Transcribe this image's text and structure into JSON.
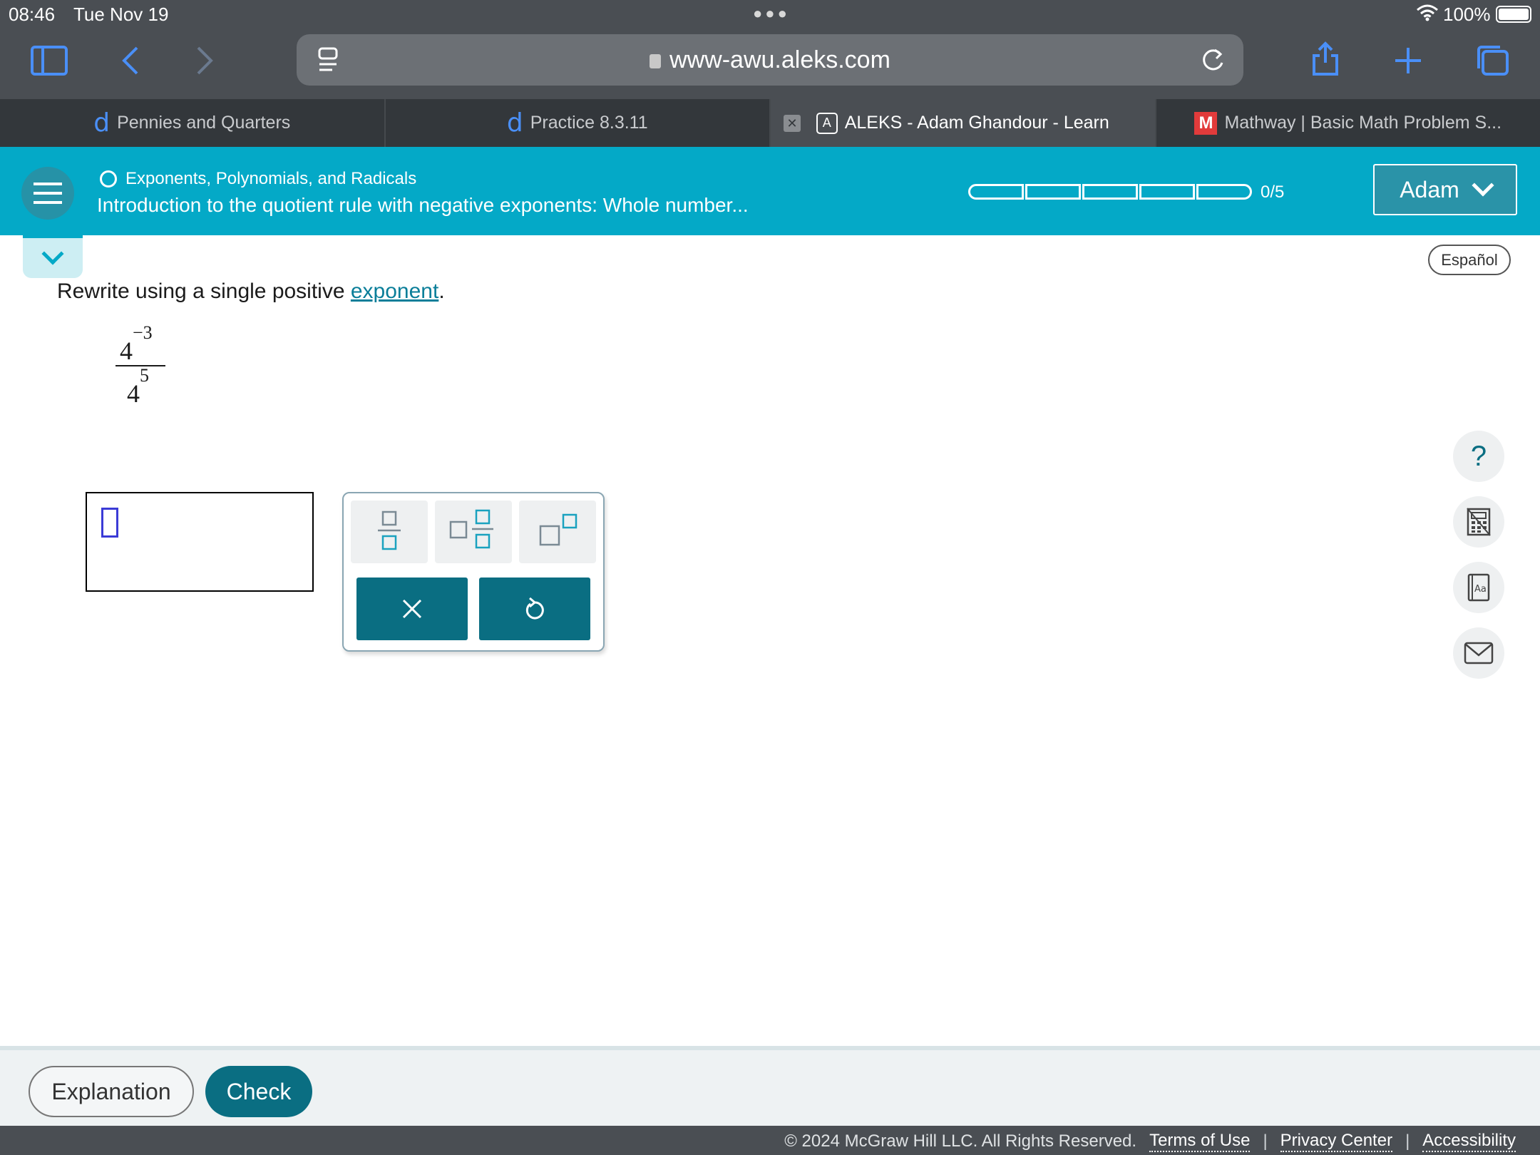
{
  "status_bar": {
    "time": "08:46",
    "date": "Tue Nov 19",
    "battery": "100%"
  },
  "browser": {
    "url": "www-awu.aleks.com",
    "tabs": [
      {
        "label": "Pennies and Quarters",
        "favicon": "d"
      },
      {
        "label": "Practice 8.3.11",
        "favicon": "d"
      },
      {
        "label": "ALEKS - Adam Ghandour - Learn",
        "favicon": "A"
      },
      {
        "label": "Mathway | Basic Math Problem S...",
        "favicon": "M"
      }
    ]
  },
  "header": {
    "topic": "Exponents, Polynomials, and Radicals",
    "lesson": "Introduction to the quotient rule with negative exponents: Whole number...",
    "progress_label": "0/5",
    "progress": {
      "completed": 0,
      "total": 5
    },
    "user": "Adam"
  },
  "content": {
    "language_button": "Español",
    "prompt_text": "Rewrite using a single positive ",
    "prompt_link": "exponent",
    "prompt_end": ".",
    "expression": {
      "num_base": "4",
      "num_exp": "−3",
      "den_base": "4",
      "den_exp": "5"
    }
  },
  "side_tools": {
    "help": "?"
  },
  "bottom": {
    "explanation": "Explanation",
    "check": "Check"
  },
  "footer": {
    "copyright": "© 2024 McGraw Hill LLC. All Rights Reserved.",
    "terms": "Terms of Use",
    "privacy": "Privacy Center",
    "accessibility": "Accessibility",
    "separator": "|"
  },
  "colors": {
    "accent": "#04a9c7",
    "primary_button": "#0a6e82",
    "browser_chrome": "#4a4e53"
  }
}
